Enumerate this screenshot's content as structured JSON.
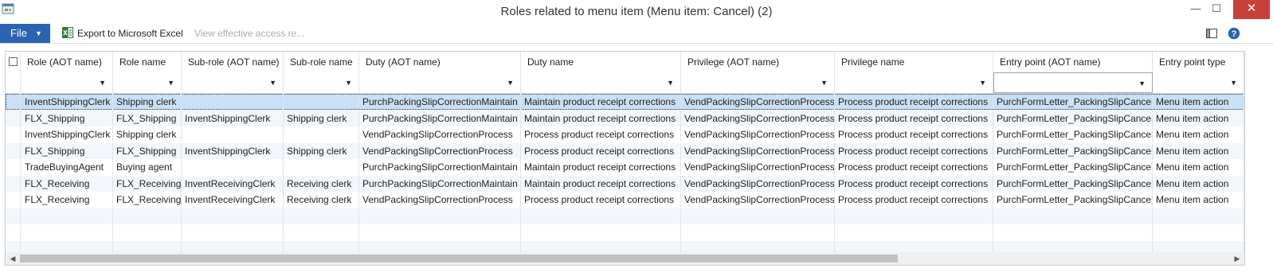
{
  "window": {
    "title": "Roles related to menu item (Menu item: Cancel) (2)",
    "close_glyph": "✕",
    "maximize_glyph": "☐",
    "minimize_glyph": "—"
  },
  "toolbar": {
    "file_label": "File",
    "file_arrow": "▼",
    "export_label": "Export to Microsoft Excel",
    "view_access_label": "View effective access re..."
  },
  "icons": {
    "app": "app-window-icon",
    "excel": "excel-icon",
    "layout": "layout-pane-icon",
    "help": "help-icon"
  },
  "colors": {
    "file_button": "#2a63b0",
    "close_button": "#c7403a",
    "selected_row": "#c9e0f7",
    "alt_row": "#f3f6fb"
  },
  "grid": {
    "columns": [
      "Role (AOT name)",
      "Role name",
      "Sub-role (AOT name)",
      "Sub-role name",
      "Duty (AOT name)",
      "Duty name",
      "Privilege (AOT name)",
      "Privilege name",
      "Entry point (AOT name)",
      "Entry point type"
    ],
    "rows": [
      [
        "InventShippingClerk",
        "Shipping clerk",
        "",
        "",
        "PurchPackingSlipCorrectionMaintain",
        "Maintain product receipt corrections",
        "VendPackingSlipCorrectionProcess",
        "Process product receipt corrections",
        "PurchFormLetter_PackingSlipCancel",
        "Menu item action"
      ],
      [
        "FLX_Shipping",
        "FLX_Shipping",
        "InventShippingClerk",
        "Shipping clerk",
        "PurchPackingSlipCorrectionMaintain",
        "Maintain product receipt corrections",
        "VendPackingSlipCorrectionProcess",
        "Process product receipt corrections",
        "PurchFormLetter_PackingSlipCancel",
        "Menu item action"
      ],
      [
        "InventShippingClerk",
        "Shipping clerk",
        "",
        "",
        "VendPackingSlipCorrectionProcess",
        "Process product receipt corrections",
        "VendPackingSlipCorrectionProcess",
        "Process product receipt corrections",
        "PurchFormLetter_PackingSlipCancel",
        "Menu item action"
      ],
      [
        "FLX_Shipping",
        "FLX_Shipping",
        "InventShippingClerk",
        "Shipping clerk",
        "VendPackingSlipCorrectionProcess",
        "Process product receipt corrections",
        "VendPackingSlipCorrectionProcess",
        "Process product receipt corrections",
        "PurchFormLetter_PackingSlipCancel",
        "Menu item action"
      ],
      [
        "TradeBuyingAgent",
        "Buying agent",
        "",
        "",
        "PurchPackingSlipCorrectionMaintain",
        "Maintain product receipt corrections",
        "VendPackingSlipCorrectionProcess",
        "Process product receipt corrections",
        "PurchFormLetter_PackingSlipCancel",
        "Menu item action"
      ],
      [
        "FLX_Receiving",
        "FLX_Receiving",
        "InventReceivingClerk",
        "Receiving clerk",
        "PurchPackingSlipCorrectionMaintain",
        "Maintain product receipt corrections",
        "VendPackingSlipCorrectionProcess",
        "Process product receipt corrections",
        "PurchFormLetter_PackingSlipCancel",
        "Menu item action"
      ],
      [
        "FLX_Receiving",
        "FLX_Receiving",
        "InventReceivingClerk",
        "Receiving clerk",
        "VendPackingSlipCorrectionProcess",
        "Process product receipt corrections",
        "VendPackingSlipCorrectionProcess",
        "Process product receipt corrections",
        "PurchFormLetter_PackingSlipCancel",
        "Menu item action"
      ]
    ],
    "selected_row": 0,
    "filter_arrow": "▼",
    "scroll_left": "◀",
    "scroll_right": "▶"
  }
}
